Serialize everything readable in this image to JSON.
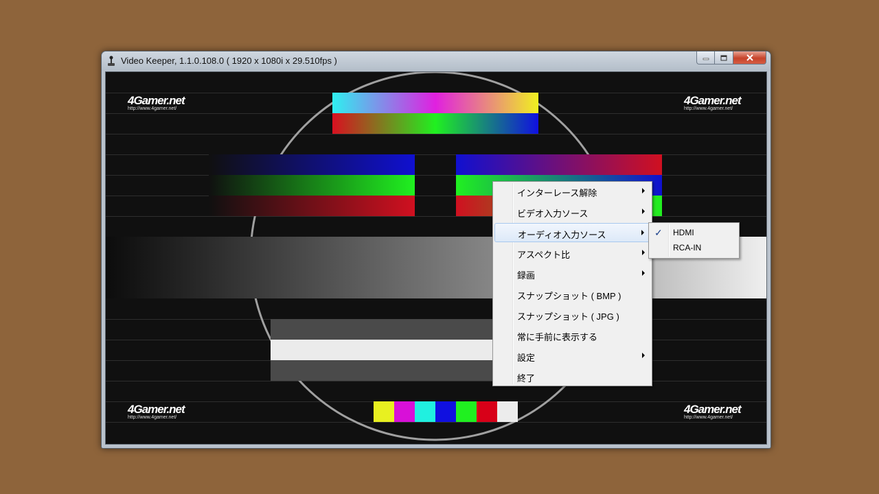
{
  "window": {
    "title": "Video Keeper, 1.1.0.108.0 ( 1920 x 1080i x 29.510fps )",
    "icon": "app-joystick-icon"
  },
  "caption_buttons": [
    "minimize-icon",
    "maximize-icon",
    "close-icon"
  ],
  "video": {
    "watermark_title": "4Gamer.net",
    "watermark_url": "http://www.4gamer.net/"
  },
  "context_menu": {
    "items": [
      {
        "label": "インターレース解除",
        "submenu": true
      },
      {
        "label": "ビデオ入力ソース",
        "submenu": true
      },
      {
        "label": "オーディオ入力ソース",
        "submenu": true,
        "highlighted": true
      },
      {
        "label": "アスペクト比",
        "submenu": true
      },
      {
        "label": "録画",
        "submenu": true
      },
      {
        "label": "スナップショット ( BMP )",
        "submenu": false
      },
      {
        "label": "スナップショット ( JPG )",
        "submenu": false
      },
      {
        "label": "常に手前に表示する",
        "submenu": false
      },
      {
        "label": "設定",
        "submenu": true
      },
      {
        "label": "終了",
        "submenu": false
      }
    ]
  },
  "audio_submenu": {
    "items": [
      {
        "label": "HDMI",
        "checked": true
      },
      {
        "label": "RCA-IN",
        "checked": false
      }
    ]
  },
  "colors": {
    "desktop": "#8e643b",
    "menu_highlight": "#dde9f8"
  }
}
